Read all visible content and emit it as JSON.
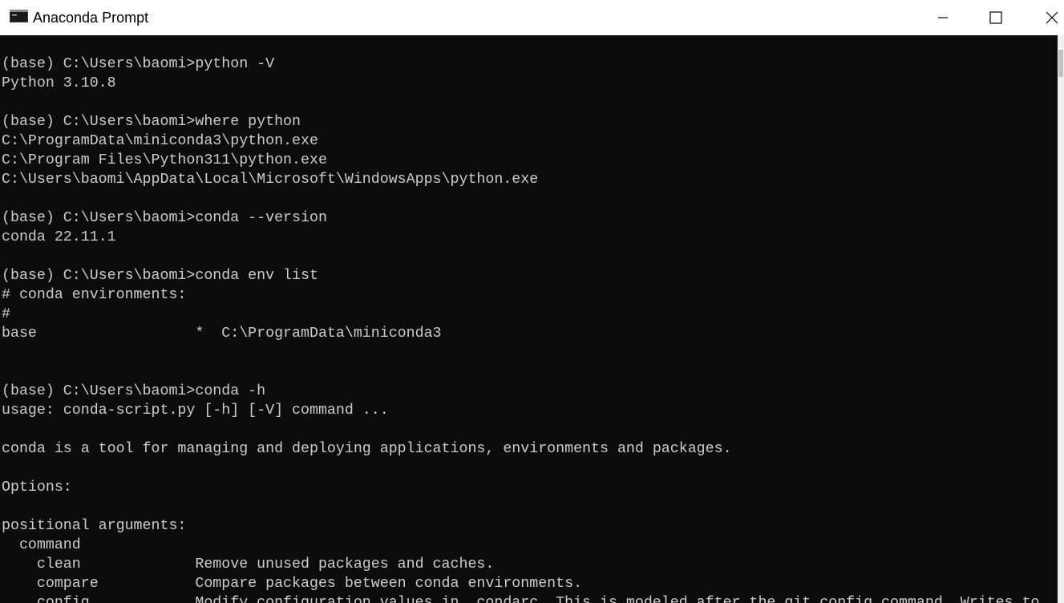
{
  "window": {
    "title": "Anaconda Prompt",
    "icon": "console-icon"
  },
  "controls": {
    "minimize": "minimize-icon",
    "maximize": "maximize-icon",
    "close": "close-icon"
  },
  "terminal": {
    "lines": [
      "(base) C:\\Users\\baomi>python -V",
      "Python 3.10.8",
      "",
      "(base) C:\\Users\\baomi>where python",
      "C:\\ProgramData\\miniconda3\\python.exe",
      "C:\\Program Files\\Python311\\python.exe",
      "C:\\Users\\baomi\\AppData\\Local\\Microsoft\\WindowsApps\\python.exe",
      "",
      "(base) C:\\Users\\baomi>conda --version",
      "conda 22.11.1",
      "",
      "(base) C:\\Users\\baomi>conda env list",
      "# conda environments:",
      "#",
      "base                  *  C:\\ProgramData\\miniconda3",
      "",
      "",
      "(base) C:\\Users\\baomi>conda -h",
      "usage: conda-script.py [-h] [-V] command ...",
      "",
      "conda is a tool for managing and deploying applications, environments and packages.",
      "",
      "Options:",
      "",
      "positional arguments:",
      "  command",
      "    clean             Remove unused packages and caches.",
      "    compare           Compare packages between conda environments.",
      "    config            Modify configuration values in .condarc. This is modeled after the git config command. Writes to"
    ]
  },
  "colors": {
    "terminal_bg": "#0c0c0c",
    "terminal_fg": "#cccccc",
    "titlebar_bg": "#ffffff"
  }
}
